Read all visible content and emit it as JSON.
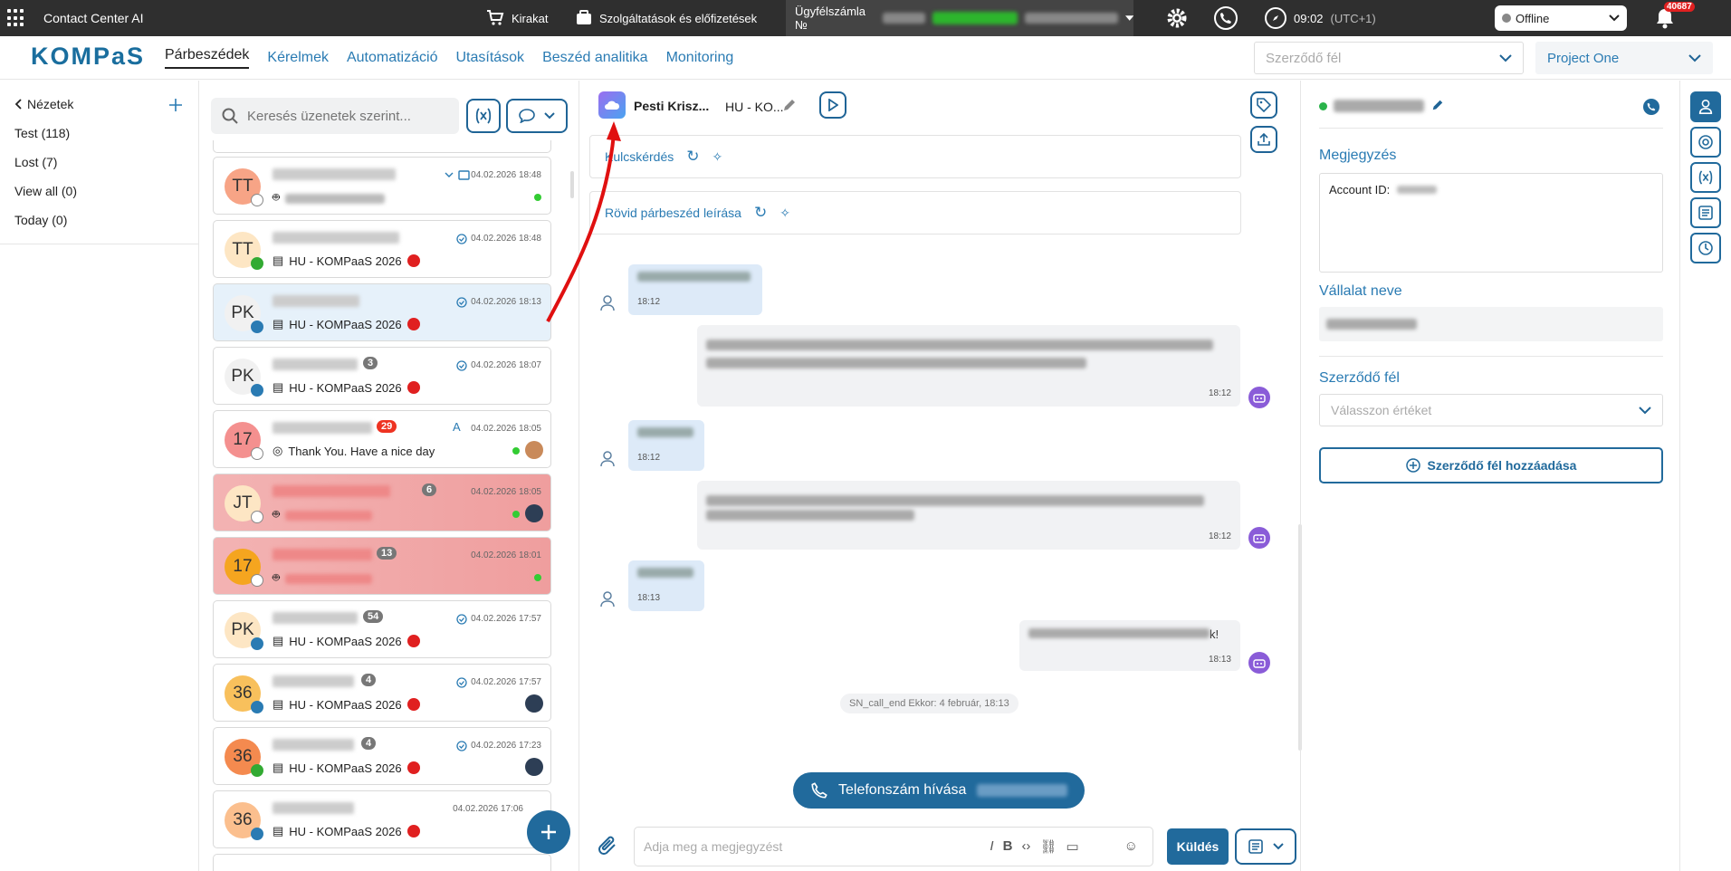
{
  "topbar": {
    "app_name": "Contact Center AI",
    "store": "Kirakat",
    "services": "Szolgáltatások és előfizetések",
    "account_prefix": "Ügyfélszámla №",
    "time": "09:02",
    "timezone": "(UTC+1)",
    "status": "Offline",
    "notif_count": "40687"
  },
  "nav": {
    "logo": "KOMPaS",
    "tabs": [
      "Párbeszédek",
      "Kérelmek",
      "Automatizáció",
      "Utasítások",
      "Beszéd analitika",
      "Monitoring"
    ],
    "party_placeholder": "Szerződő fél",
    "project": "Project One"
  },
  "views": {
    "back_label": "Nézetek",
    "items": [
      "Test (118)",
      "Lost (7)",
      "View all (0)",
      "Today (0)"
    ]
  },
  "list": {
    "search_placeholder": "Keresés üzenetek szerint...",
    "items": [
      {
        "initials": "TT",
        "time": "04.02.2026 18:48",
        "line": "",
        "count": ""
      },
      {
        "initials": "TT",
        "time": "04.02.2026 18:48",
        "line": "HU - KOMPaaS 2026",
        "count": ""
      },
      {
        "initials": "PK",
        "time": "04.02.2026 18:13",
        "line": "HU - KOMPaaS 2026",
        "count": ""
      },
      {
        "initials": "PK",
        "time": "04.02.2026 18:07",
        "line": "HU - KOMPaaS 2026",
        "count": "3"
      },
      {
        "initials": "17",
        "time": "04.02.2026 18:05",
        "line": "Thank You. Have a nice day",
        "count": "29"
      },
      {
        "initials": "JT",
        "time": "04.02.2026 18:05",
        "line": "",
        "count": "6"
      },
      {
        "initials": "17",
        "time": "04.02.2026 18:01",
        "line": "",
        "count": "13"
      },
      {
        "initials": "PK",
        "time": "04.02.2026 17:57",
        "line": "HU - KOMPaaS 2026",
        "count": "54"
      },
      {
        "initials": "36",
        "time": "04.02.2026 17:57",
        "line": "HU - KOMPaaS 2026",
        "count": "4"
      },
      {
        "initials": "36",
        "time": "04.02.2026 17:23",
        "line": "HU - KOMPaaS 2026",
        "count": "4"
      },
      {
        "initials": "36",
        "time": "04.02.2026 17:06",
        "line": "HU - KOMPaaS 2026",
        "count": ""
      }
    ]
  },
  "chat": {
    "contact_name": "Pesti Krisz...",
    "channel": "HU - KO...",
    "key_question": "Kulcskérdés",
    "summary": "Rövid párbeszéd leírása",
    "messages": [
      {
        "time": "18:12"
      },
      {
        "time": "18:12"
      },
      {
        "time": "18:12"
      },
      {
        "time": "18:12"
      },
      {
        "time": "18:13"
      },
      {
        "time": "18:13"
      }
    ],
    "last_msg_suffix": "k!",
    "system_note": "SN_call_end Ekkor: 4 február, 18:13",
    "call_button": "Telefonszám hívása",
    "input_placeholder": "Adja meg a megjegyzést",
    "send": "Küldés"
  },
  "right": {
    "note_label": "Megjegyzés",
    "note_text": "Account ID:",
    "company_label": "Vállalat neve",
    "party_label": "Szerződő fél",
    "party_placeholder": "Válasszon értéket",
    "add_party": "Szerződő fél hozzáadása"
  },
  "colors": {
    "brand": "#216a9c",
    "link": "#2a7bb3",
    "topbar": "#2f2f2f",
    "bot": "#8a5cd8",
    "alert": "#ef9e9e"
  }
}
